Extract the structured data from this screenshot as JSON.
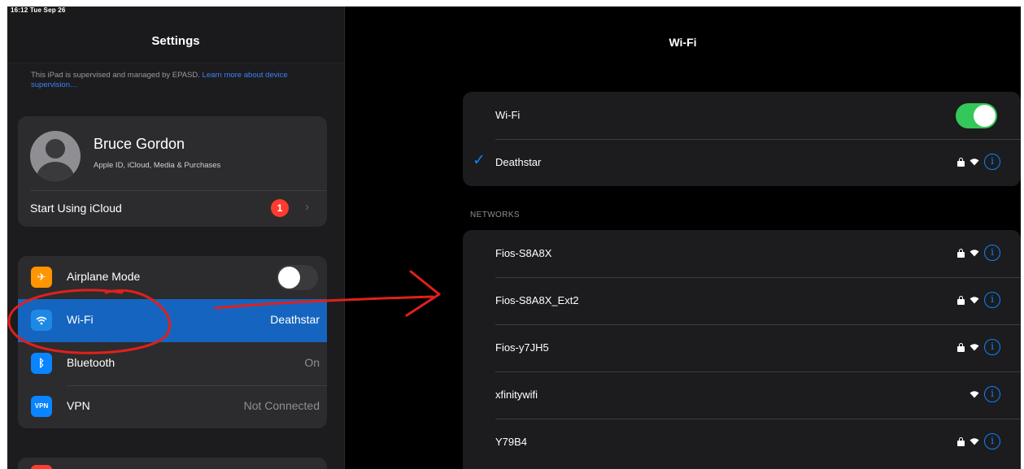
{
  "status_bar": {
    "time": "16:12  Tue Sep 26"
  },
  "sidebar": {
    "title": "Settings",
    "supervision_text": "This iPad is supervised and managed by EPASD.",
    "supervision_link": "Learn more about device supervision…",
    "profile": {
      "name": "Bruce Gordon",
      "subtitle": "Apple ID, iCloud, Media & Purchases",
      "icloud_label": "Start Using iCloud",
      "icloud_badge": "1"
    },
    "items": [
      {
        "label": "Airplane Mode",
        "icon": "airplane-icon",
        "toggle": "off"
      },
      {
        "label": "Wi-Fi",
        "icon": "wifi-icon",
        "value": "Deathstar",
        "selected": true
      },
      {
        "label": "Bluetooth",
        "icon": "bluetooth-icon",
        "value": "On"
      },
      {
        "label": "VPN",
        "icon": "vpn-icon",
        "icon_text": "VPN",
        "value": "Not Connected"
      }
    ]
  },
  "detail": {
    "title": "Wi-Fi",
    "wifi_label": "Wi-Fi",
    "wifi_toggle": "on",
    "connected_network": "Deathstar",
    "networks_header": "NETWORKS",
    "networks": [
      {
        "name": "Fios-S8A8X",
        "secured": true
      },
      {
        "name": "Fios-S8A8X_Ext2",
        "secured": true
      },
      {
        "name": "Fios-y7JH5",
        "secured": true
      },
      {
        "name": "xfinitywifi",
        "secured": false
      },
      {
        "name": "Y79B4",
        "secured": true
      }
    ]
  },
  "colors": {
    "accent_blue": "#0a84ff",
    "selected_row": "#1565c0",
    "toggle_on": "#34c759",
    "badge_red": "#ff3b30",
    "airplane_orange": "#ff9500",
    "annotation_red": "#e0201b"
  }
}
